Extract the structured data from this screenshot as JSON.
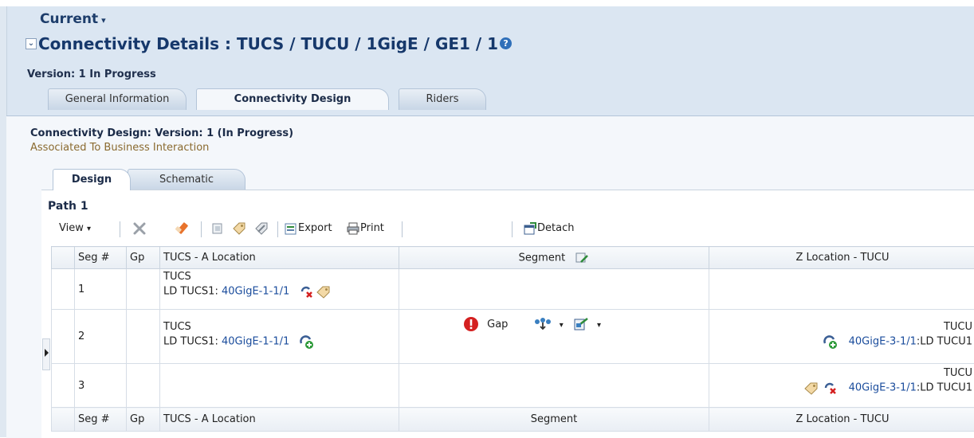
{
  "header": {
    "current_label": "Current",
    "title": "Connectivity Details : TUCS / TUCU / 1GigE / GE1 / 1",
    "version": "Version: 1 In Progress"
  },
  "tabs": [
    {
      "label": "General Information",
      "active": false
    },
    {
      "label": "Connectivity Design",
      "active": true
    },
    {
      "label": "Riders",
      "active": false
    }
  ],
  "design": {
    "title": "Connectivity Design: Version: 1 (In Progress)",
    "subtitle": "Associated To Business Interaction",
    "subtabs": [
      {
        "label": "Design",
        "active": true
      },
      {
        "label": "Schematic",
        "active": false
      }
    ],
    "path_label": "Path 1"
  },
  "toolbar": {
    "view_label": "View",
    "export_label": "Export",
    "print_label": "Print",
    "detach_label": "Detach"
  },
  "table": {
    "columns": [
      "Seg #",
      "Gp",
      "TUCS - A Location",
      "Segment",
      "Z Location - TUCU"
    ],
    "rows": [
      {
        "seg": "1",
        "a_site": "TUCS",
        "a_prefix": "LD TUCS1:",
        "a_port": "40GigE-1-1/1",
        "segment": "",
        "z_site": "",
        "z_port": "",
        "z_suffix": ""
      },
      {
        "seg": "2",
        "a_site": "TUCS",
        "a_prefix": "LD TUCS1:",
        "a_port": "40GigE-1-1/1",
        "segment": "Gap",
        "z_site": "TUCU",
        "z_port": "40GigE-3-1/1",
        "z_suffix": ":LD TUCU1"
      },
      {
        "seg": "3",
        "a_site": "",
        "a_prefix": "",
        "a_port": "",
        "segment": "",
        "z_site": "TUCU",
        "z_port": "40GigE-3-1/1",
        "z_suffix": ":LD TUCU1"
      }
    ],
    "footer_columns": [
      "Seg #",
      "Gp",
      "TUCS - A Location",
      "Segment",
      "Z Location - TUCU"
    ]
  },
  "colors": {
    "header_bg": "#dbe6f2",
    "title_blue": "#16386b",
    "link_blue": "#1a4c9c",
    "warning_red": "#d42020"
  }
}
